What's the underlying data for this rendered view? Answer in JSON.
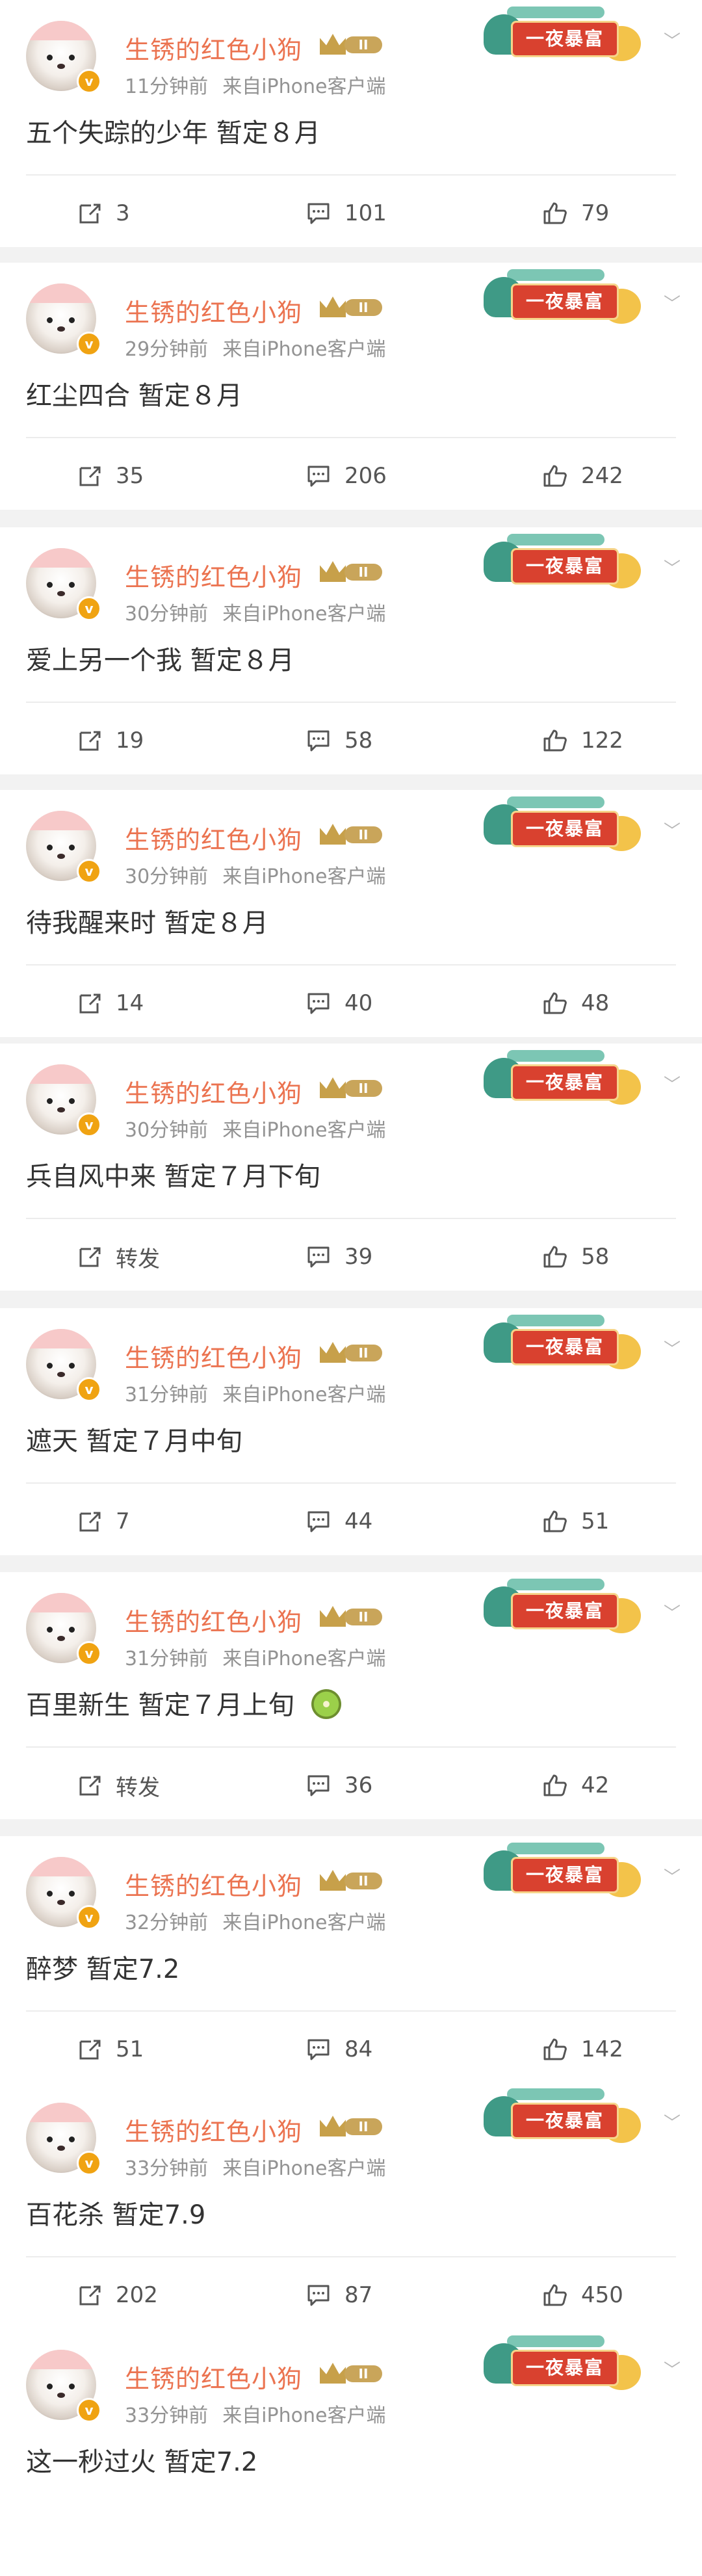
{
  "labels": {
    "source": "来自iPhone客户端",
    "banner": "一夜暴富",
    "level": "II",
    "verified": "v"
  },
  "user": {
    "name": "生锈的红色小狗"
  },
  "posts": [
    {
      "time": "11分钟前",
      "text": "五个失踪的少年 暂定８月",
      "repost": "3",
      "comment": "101",
      "like": "79"
    },
    {
      "time": "29分钟前",
      "text": "红尘四合 暂定８月",
      "repost": "35",
      "comment": "206",
      "like": "242"
    },
    {
      "time": "30分钟前",
      "text": "爱上另一个我 暂定８月",
      "repost": "19",
      "comment": "58",
      "like": "122"
    },
    {
      "time": "30分钟前",
      "text": "待我醒来时 暂定８月",
      "repost": "14",
      "comment": "40",
      "like": "48"
    },
    {
      "time": "30分钟前",
      "text": "兵自风中来 暂定７月下旬",
      "repost": "转发",
      "comment": "39",
      "like": "58"
    },
    {
      "time": "31分钟前",
      "text": "遮天 暂定７月中旬",
      "repost": "7",
      "comment": "44",
      "like": "51"
    },
    {
      "time": "31分钟前",
      "text": "百里新生 暂定７月上旬",
      "repost": "转发",
      "comment": "36",
      "like": "42",
      "emoji": "kiwi"
    },
    {
      "time": "32分钟前",
      "text": "醉梦 暂定7.2",
      "repost": "51",
      "comment": "84",
      "like": "142"
    },
    {
      "time": "33分钟前",
      "text": "百花杀 暂定7.9",
      "repost": "202",
      "comment": "87",
      "like": "450"
    },
    {
      "time": "33分钟前",
      "text": "这一秒过火 暂定7.2"
    }
  ]
}
